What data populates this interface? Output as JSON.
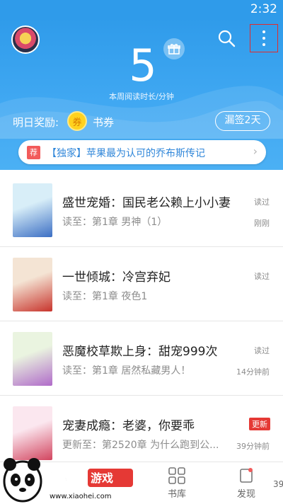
{
  "status_bar": {
    "time": "2:32"
  },
  "header": {
    "minutes": "5",
    "minutes_label": "本周阅读时长/分钟",
    "reward_label": "明日奖励:",
    "coin_icon_text": "券",
    "coupon_label": "书券",
    "leak_sign_button": "漏签2天"
  },
  "banner": {
    "tag": "荐",
    "text": "【独家】苹果最为认可的乔布斯传记",
    "arrow": "›"
  },
  "books": [
    {
      "title": "盛世宠婚：国民老公赖上小小妻",
      "progress": "读至：第1章 男神（1）",
      "status": "读过",
      "time": "刚刚",
      "status_type": "read",
      "cover_colors": [
        "#d8eef8",
        "#3c6fc4"
      ]
    },
    {
      "title": "一世倾城：冷宫弃妃",
      "progress": "读至：第1章 夜色1",
      "status": "读过",
      "time": "",
      "status_type": "read",
      "cover_colors": [
        "#f4e4d4",
        "#c8342c"
      ]
    },
    {
      "title": "恶魔校草欺上身：甜宠999次",
      "progress": "读至：第1章 居然私藏男人！",
      "status": "读过",
      "time": "14分钟前",
      "status_type": "read",
      "cover_colors": [
        "#eaf4e0",
        "#b06bc9"
      ]
    },
    {
      "title": "宠妻成瘾：老婆，你要乖",
      "progress": "更新至：第2520章 为什么跑到公...",
      "status": "更新",
      "time": "39分钟前",
      "status_type": "update",
      "cover_colors": [
        "#fbe7ef",
        "#d2455f"
      ]
    }
  ],
  "bottom_nav": {
    "library": "书库",
    "discover": "发现",
    "extra": "39"
  },
  "watermark": {
    "text": "小黑游戏",
    "url": "www.xiaohei.com"
  },
  "icons": {
    "search": "search-icon",
    "more": "more-vertical-icon",
    "gift": "gift-icon",
    "coin": "coupon-coin-icon",
    "library": "library-grid-icon",
    "discover": "discover-icon"
  },
  "colors": {
    "header_blue": "#2f9bea",
    "link_blue": "#2f86d9",
    "tag_red": "#f25b5b",
    "update_red": "#e53935",
    "coin_yellow": "#ffd21f"
  }
}
